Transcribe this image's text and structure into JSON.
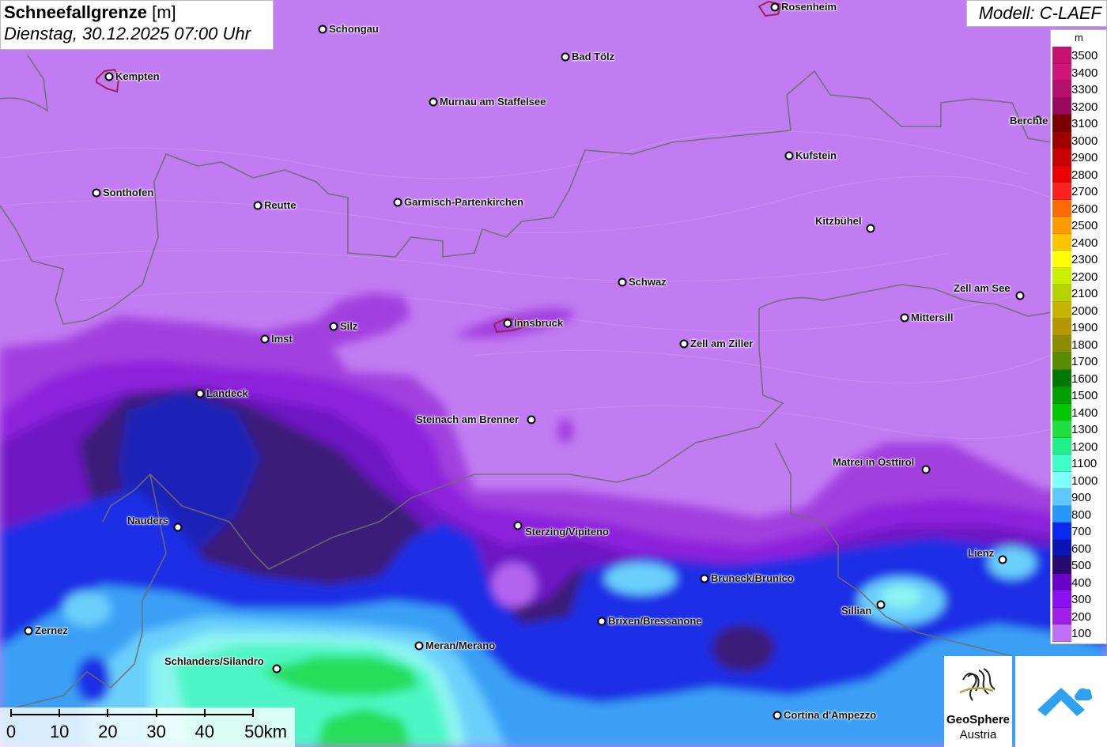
{
  "title": {
    "parameter": "Schneefallgrenze",
    "unit": "[m]",
    "date": "Dienstag, 30.12.2025 07:00 Uhr"
  },
  "model": "Modell: C-LAEF",
  "legend": {
    "unit": "m",
    "levels": [
      {
        "label": "3500",
        "color": "#c8106e"
      },
      {
        "label": "3400",
        "color": "#d0147a"
      },
      {
        "label": "3300",
        "color": "#b40f6a"
      },
      {
        "label": "3200",
        "color": "#9a0a5c"
      },
      {
        "label": "3100",
        "color": "#7a0000"
      },
      {
        "label": "3000",
        "color": "#a00000"
      },
      {
        "label": "2900",
        "color": "#c80000"
      },
      {
        "label": "2800",
        "color": "#e80000"
      },
      {
        "label": "2700",
        "color": "#ff2020"
      },
      {
        "label": "2600",
        "color": "#ff6a00"
      },
      {
        "label": "2500",
        "color": "#ff9a00"
      },
      {
        "label": "2400",
        "color": "#ffc400"
      },
      {
        "label": "2300",
        "color": "#ffff00"
      },
      {
        "label": "2200",
        "color": "#c8f000"
      },
      {
        "label": "2100",
        "color": "#b4d200"
      },
      {
        "label": "2000",
        "color": "#c8b400"
      },
      {
        "label": "1900",
        "color": "#b49600"
      },
      {
        "label": "1800",
        "color": "#8c8c00"
      },
      {
        "label": "1700",
        "color": "#5a8c00"
      },
      {
        "label": "1600",
        "color": "#007800"
      },
      {
        "label": "1500",
        "color": "#00a000"
      },
      {
        "label": "1400",
        "color": "#00c800"
      },
      {
        "label": "1300",
        "color": "#20e040"
      },
      {
        "label": "1200",
        "color": "#20f08c"
      },
      {
        "label": "1100",
        "color": "#40ffc8"
      },
      {
        "label": "1000",
        "color": "#80ffff"
      },
      {
        "label": "900",
        "color": "#60c8ff"
      },
      {
        "label": "800",
        "color": "#2896ff"
      },
      {
        "label": "700",
        "color": "#0a28f0"
      },
      {
        "label": "600",
        "color": "#0a14b4"
      },
      {
        "label": "500",
        "color": "#2a0a6e"
      },
      {
        "label": "400",
        "color": "#6a00c8"
      },
      {
        "label": "300",
        "color": "#8a10f0"
      },
      {
        "label": "200",
        "color": "#a020e8"
      },
      {
        "label": "100",
        "color": "#c070f8"
      }
    ]
  },
  "scale": {
    "labels": [
      "0",
      "10",
      "20",
      "30",
      "40",
      "50km"
    ]
  },
  "logo": {
    "name": "GeoSphere",
    "country": "Austria"
  },
  "cities": [
    {
      "name": "Rosenheim"
    },
    {
      "name": "Schongau"
    },
    {
      "name": "Kempten"
    },
    {
      "name": "Bad Tölz"
    },
    {
      "name": "Murnau am Staffelsee"
    },
    {
      "name": "Berchte"
    },
    {
      "name": "Kufstein"
    },
    {
      "name": "Sonthofen"
    },
    {
      "name": "Reutte"
    },
    {
      "name": "Garmisch-Partenkirchen"
    },
    {
      "name": "Kitzbühel"
    },
    {
      "name": "Schwaz"
    },
    {
      "name": "Zell am See"
    },
    {
      "name": "Silz"
    },
    {
      "name": "Innsbruck"
    },
    {
      "name": "Imst"
    },
    {
      "name": "Mittersill"
    },
    {
      "name": "Zell am Ziller"
    },
    {
      "name": "Landeck"
    },
    {
      "name": "Steinach am Brenner"
    },
    {
      "name": "Matrei in Osttirol"
    },
    {
      "name": "Nauders"
    },
    {
      "name": "Sterzing/Vipiteno"
    },
    {
      "name": "Lienz"
    },
    {
      "name": "Bruneck/Brunico"
    },
    {
      "name": "Sillian"
    },
    {
      "name": "Brixen/Bressanone"
    },
    {
      "name": "Zernez"
    },
    {
      "name": "Meran/Merano"
    },
    {
      "name": "Schlanders/Silandro"
    },
    {
      "name": "Cortina d'Ampezzo"
    }
  ]
}
